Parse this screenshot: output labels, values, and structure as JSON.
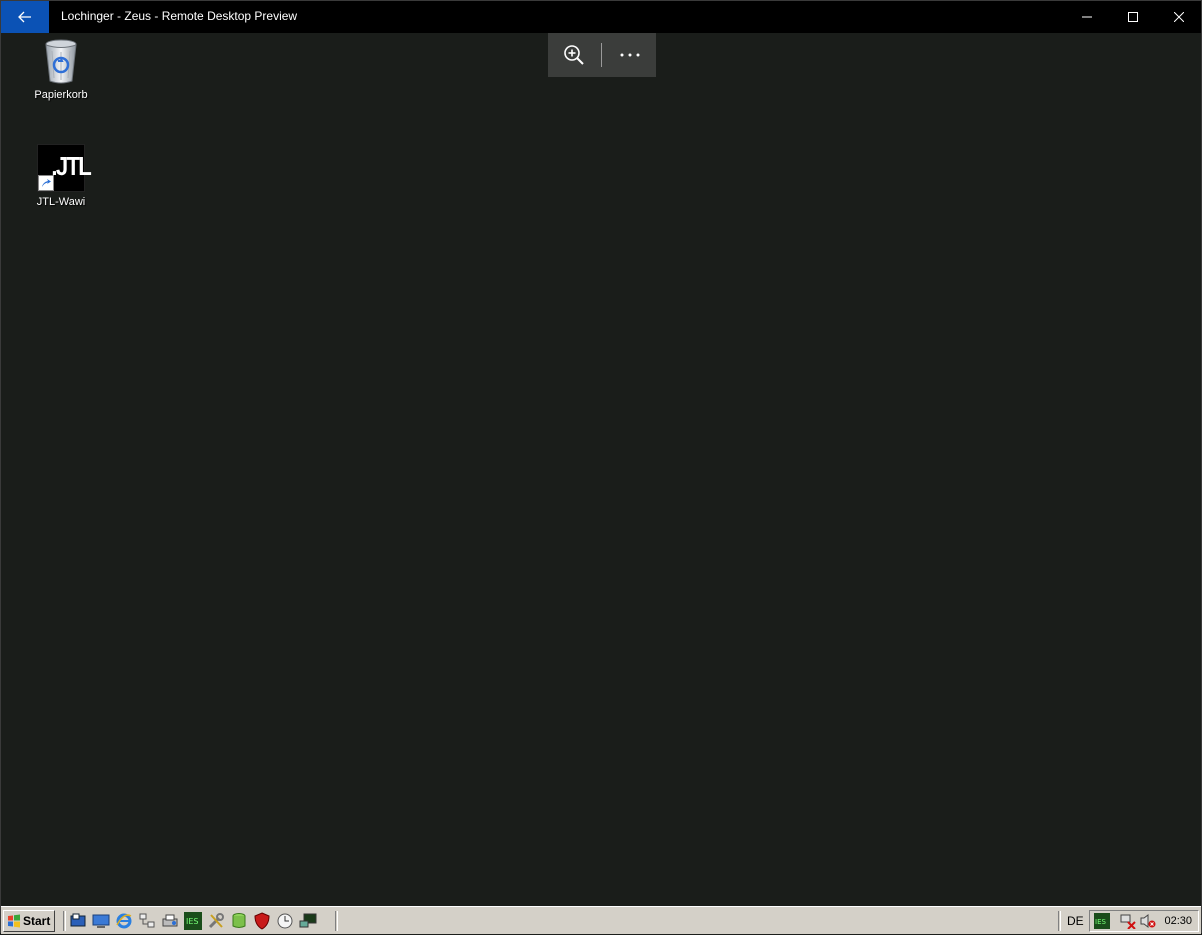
{
  "window": {
    "title": "Lochinger - Zeus - Remote Desktop Preview",
    "accent": "#0b52b5",
    "controls": [
      "minimize-icon",
      "maximize-icon",
      "close-icon"
    ]
  },
  "toolbar": {
    "zoom_icon": "zoom-in-icon",
    "more_icon": "more-icon"
  },
  "desktop": {
    "background": "#1a1d1a",
    "icons": [
      {
        "label": "Papierkorb",
        "icon": "recycle-bin-icon"
      },
      {
        "label": "JTL-Wawi",
        "icon": "jtl-wawi-icon",
        "logo_text": ".JTL"
      }
    ]
  },
  "taskbar": {
    "start_label": "Start",
    "quick_launch": [
      "show-desktop-icon",
      "server-manager-icon",
      "internet-explorer-icon",
      "network-icon",
      "printer-icon",
      "ies-icon",
      "tools-icon",
      "database-icon",
      "antivirus-icon",
      "clock-icon",
      "remote-icon"
    ],
    "language": "DE",
    "tray": [
      "ies-tray-icon",
      "network-disconnected-icon",
      "volume-muted-icon"
    ],
    "clock": "02:30"
  }
}
